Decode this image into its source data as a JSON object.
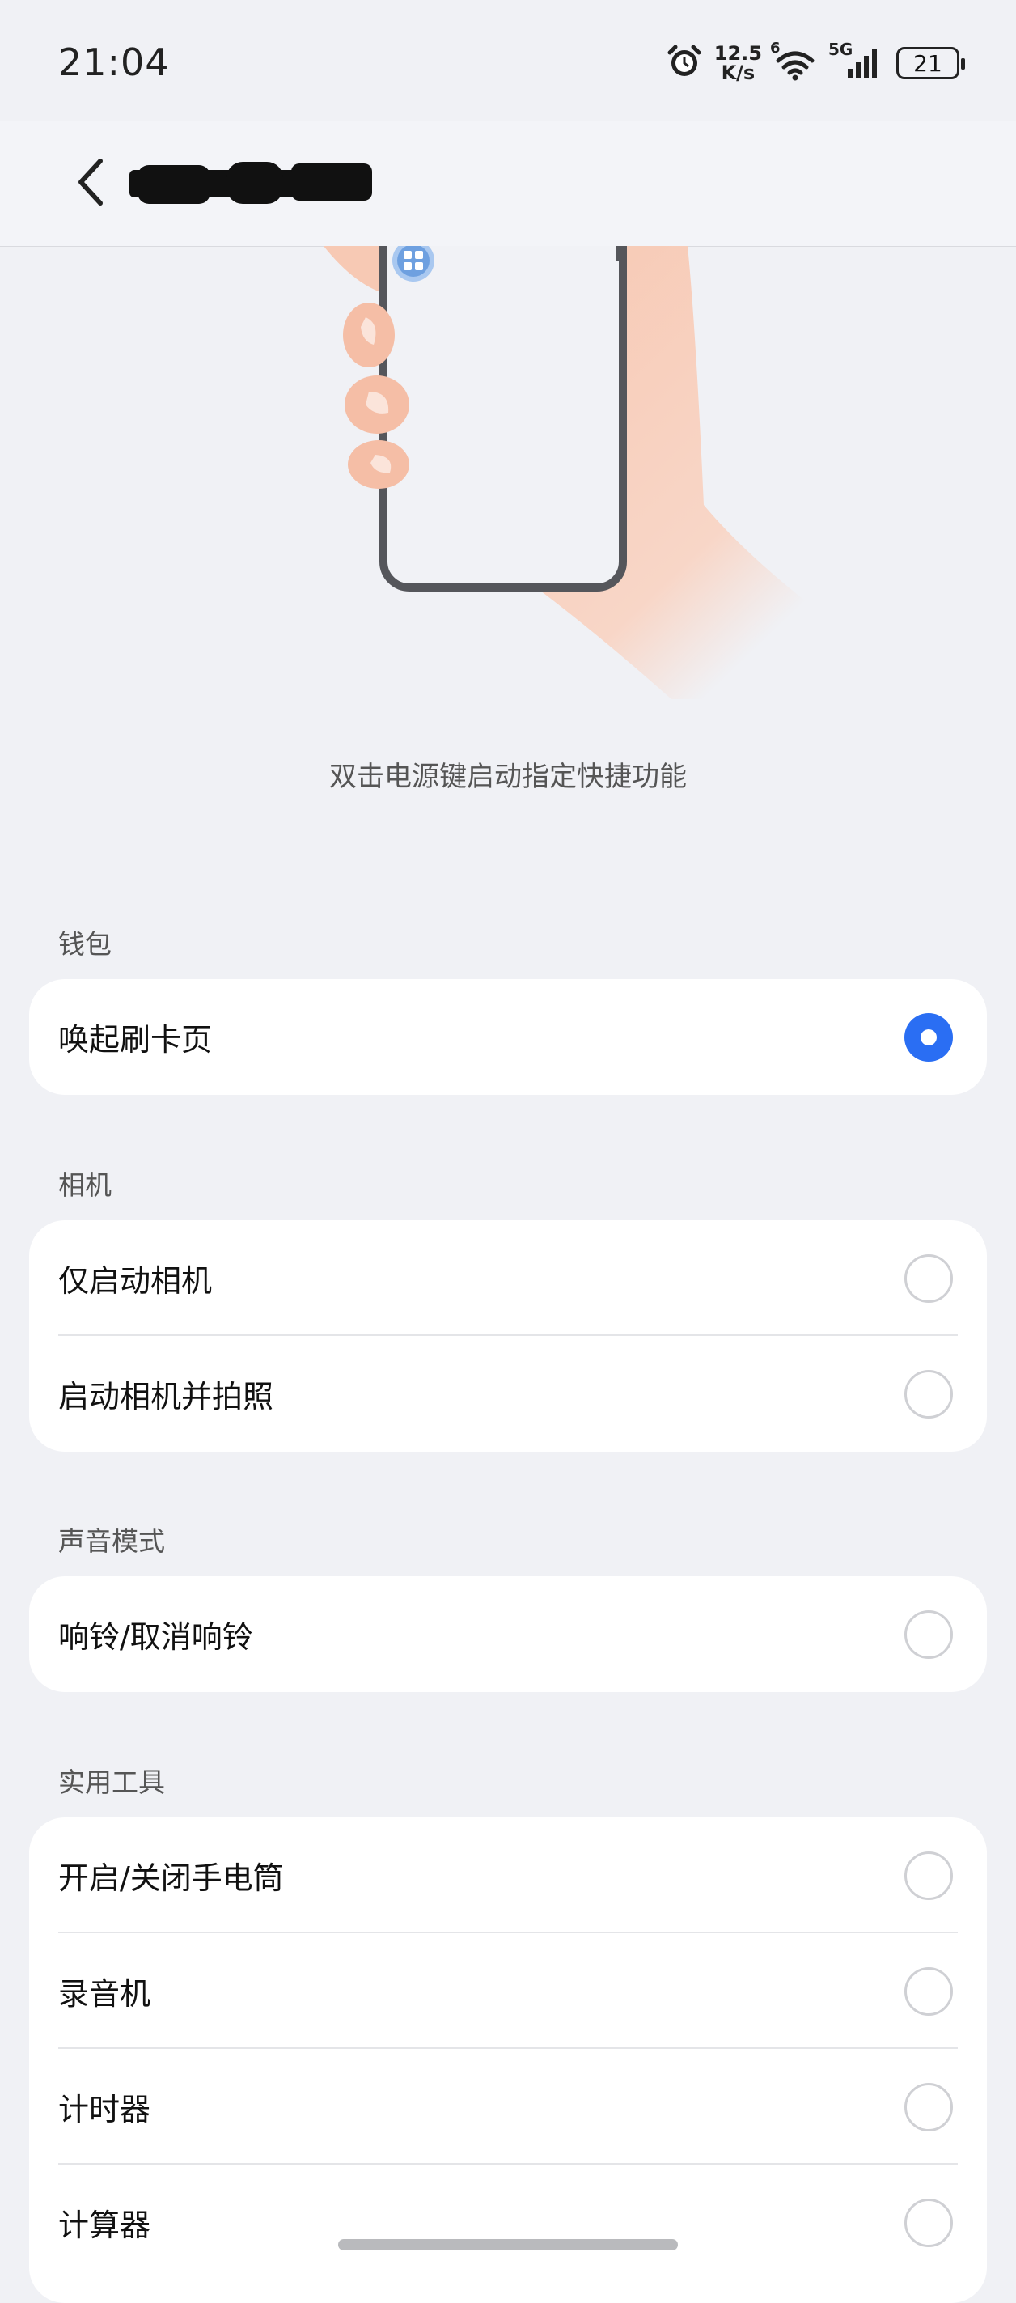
{
  "status": {
    "time": "21:04",
    "net_speed_value": "12.5",
    "net_speed_unit": "K/s",
    "wifi_badge": "6",
    "signal_badge": "5G",
    "battery": "21"
  },
  "header": {
    "back_icon": "chevron-left-icon",
    "title_redacted": true
  },
  "description": "双击电源键启动指定快捷功能",
  "sections": [
    {
      "label": "钱包",
      "options": [
        {
          "label": "唤起刷卡页",
          "selected": true
        }
      ]
    },
    {
      "label": "相机",
      "options": [
        {
          "label": "仅启动相机",
          "selected": false
        },
        {
          "label": "启动相机并拍照",
          "selected": false
        }
      ]
    },
    {
      "label": "声音模式",
      "options": [
        {
          "label": "响铃/取消响铃",
          "selected": false
        }
      ]
    },
    {
      "label": "实用工具",
      "options": [
        {
          "label": "开启/关闭手电筒",
          "selected": false
        },
        {
          "label": "录音机",
          "selected": false
        },
        {
          "label": "计时器",
          "selected": false
        },
        {
          "label": "计算器",
          "selected": false
        }
      ]
    }
  ],
  "colors": {
    "accent": "#2a6ef3",
    "background": "#f0f1f5",
    "card": "#ffffff"
  }
}
